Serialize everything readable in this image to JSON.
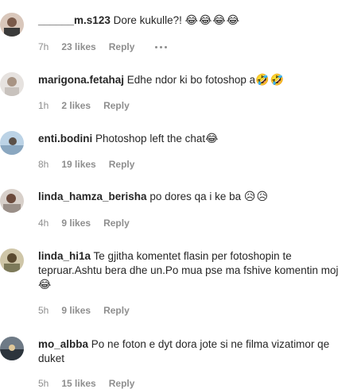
{
  "comments": [
    {
      "username": "______m.s123",
      "text": "Dore kukulle?! ",
      "emoji": "😂😂😂😂",
      "time": "7h",
      "likes": "23 likes",
      "reply": "Reply",
      "has_more": true
    },
    {
      "username": "marigona.fetahaj",
      "text": "Edhe ndor ki bo fotoshop a",
      "emoji": "🤣🤣",
      "time": "1h",
      "likes": "2 likes",
      "reply": "Reply"
    },
    {
      "username": "enti.bodini",
      "text": "Photoshop left the chat",
      "emoji": "😂",
      "time": "8h",
      "likes": "19 likes",
      "reply": "Reply"
    },
    {
      "username": "linda_hamza_berisha",
      "text": "po dores qa i ke ba ",
      "emoji": "😥😥",
      "time": "4h",
      "likes": "9 likes",
      "reply": "Reply"
    },
    {
      "username": "linda_hi1a",
      "text": "Te gjitha komentet flasin per fotoshopin te tepruar.Ashtu bera dhe un.Po mua pse ma fshive komentin moj ",
      "emoji": "😂",
      "time": "5h",
      "likes": "9 likes",
      "reply": "Reply"
    },
    {
      "username": "mo_albba",
      "text": "Po ne foton e dyt dora jote si ne filma vizatimor qe duket",
      "emoji": "",
      "time": "5h",
      "likes": "15 likes",
      "reply": "Reply"
    }
  ],
  "colors": {
    "text": "#262626",
    "meta": "#8e8e8e"
  }
}
